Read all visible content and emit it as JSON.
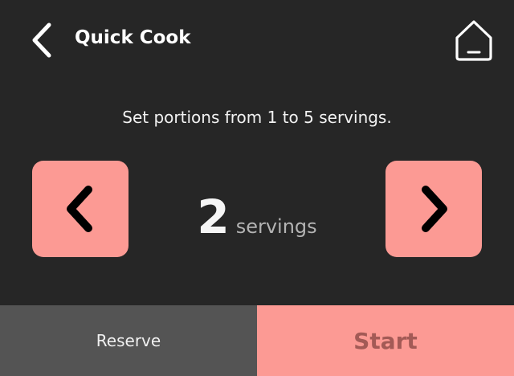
{
  "header": {
    "title": "Quick Cook",
    "back_icon": "chevron-left-icon",
    "home_icon": "home-icon"
  },
  "instructions": "Set portions from 1 to 5 servings.",
  "stepper": {
    "value": "2",
    "unit": "servings",
    "min": 1,
    "max": 5,
    "decrement_icon": "chevron-left-icon",
    "increment_icon": "chevron-right-icon"
  },
  "footer": {
    "reserve_label": "Reserve",
    "start_label": "Start"
  },
  "colors": {
    "background": "#262626",
    "accent": "#fc9a94",
    "secondary_button": "#545454",
    "start_text": "#a35a56"
  }
}
